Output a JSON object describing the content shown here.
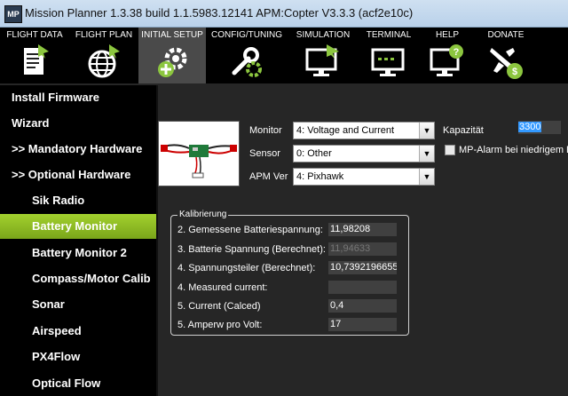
{
  "window": {
    "app_icon_text": "MP",
    "title": "Mission Planner 1.3.38 build 1.1.5983.12141 APM:Copter V3.3.3 (acf2e10c)"
  },
  "menu": {
    "items": [
      {
        "label": "FLIGHT DATA",
        "icon": "flight-data-icon"
      },
      {
        "label": "FLIGHT PLAN",
        "icon": "flight-plan-icon"
      },
      {
        "label": "INITIAL SETUP",
        "icon": "initial-setup-icon"
      },
      {
        "label": "CONFIG/TUNING",
        "icon": "config-tuning-icon"
      },
      {
        "label": "SIMULATION",
        "icon": "simulation-icon"
      },
      {
        "label": "TERMINAL",
        "icon": "terminal-icon"
      },
      {
        "label": "HELP",
        "icon": "help-icon"
      },
      {
        "label": "DONATE",
        "icon": "donate-icon"
      }
    ],
    "active_index": 2
  },
  "sidebar": {
    "items": [
      {
        "label": "Install Firmware"
      },
      {
        "label": "Wizard"
      },
      {
        "label": ">> Mandatory Hardware"
      },
      {
        "label": ">> Optional Hardware"
      },
      {
        "label": "Sik Radio"
      },
      {
        "label": "Battery Monitor"
      },
      {
        "label": "Battery Monitor 2"
      },
      {
        "label": "Compass/Motor Calib"
      },
      {
        "label": "Sonar"
      },
      {
        "label": "Airspeed"
      },
      {
        "label": "PX4Flow"
      },
      {
        "label": "Optical Flow"
      }
    ],
    "active_index": 5
  },
  "settings": {
    "monitor_label": "Monitor",
    "monitor_value": "4: Voltage and Current",
    "sensor_label": "Sensor",
    "sensor_value": "0: Other",
    "apm_ver_label": "APM Ver",
    "apm_ver_value": "4: Pixhawk",
    "capacity_label": "Kapazität",
    "capacity_value": "3300",
    "alarm_label": "MP-Alarm bei niedrigem Ba",
    "alarm_checked": false
  },
  "calibration": {
    "title": "Kalibrierung",
    "rows": [
      {
        "label": "2. Gemessene Batteriespannung:",
        "value": "11,98208"
      },
      {
        "label": "3. Batterie Spannung (Berechnet):",
        "value": "11,94633"
      },
      {
        "label": "4. Spannungsteiler (Berechnet):",
        "value": "10,7392196655"
      },
      {
        "label": "4. Measured current:",
        "value": ""
      },
      {
        "label": "5. Current (Calced)",
        "value": "0,4"
      },
      {
        "label": "5. Amperw pro Volt:",
        "value": "17"
      }
    ]
  },
  "colors": {
    "active_tab": "#a3d12e",
    "icon_green": "#8cc63f",
    "selection": "#3399ff"
  }
}
